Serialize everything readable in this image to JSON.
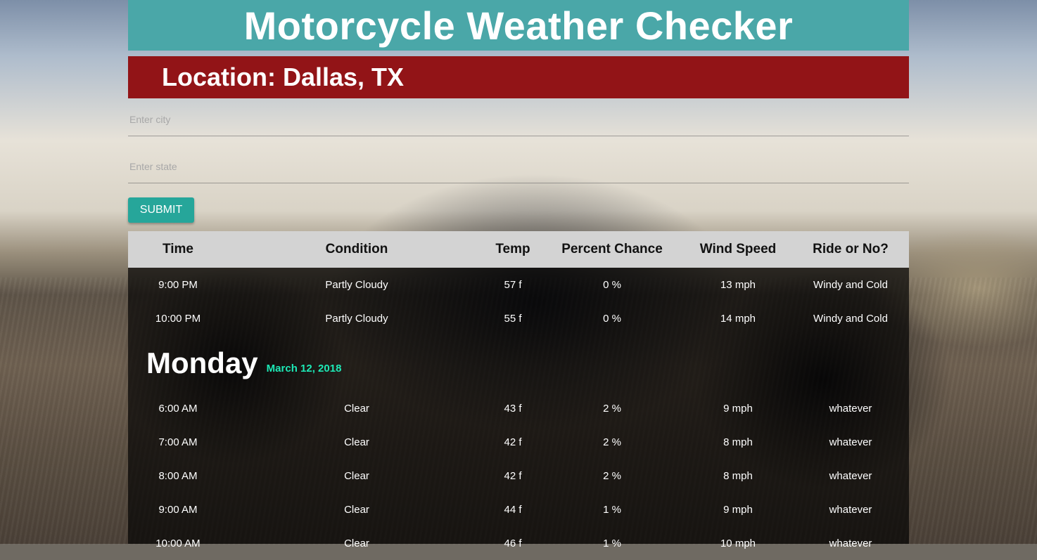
{
  "header": {
    "title": "Motorcycle Weather Checker"
  },
  "location": {
    "text": "Location: Dallas, TX"
  },
  "form": {
    "city_placeholder": "Enter city",
    "state_placeholder": "Enter state",
    "submit_label": "SUBMIT"
  },
  "table": {
    "headers": [
      "Time",
      "Condition",
      "Temp",
      "Percent Chance",
      "Wind Speed",
      "Ride or No?"
    ],
    "rows": [
      [
        "9:00 PM",
        "Partly Cloudy",
        "57 f",
        "0 %",
        "13 mph",
        "Windy and Cold"
      ],
      [
        "10:00 PM",
        "Partly Cloudy",
        "55 f",
        "0 %",
        "14 mph",
        "Windy and Cold"
      ]
    ]
  },
  "day": {
    "name": "Monday",
    "date": "March 12, 2018",
    "rows": [
      [
        "6:00 AM",
        "Clear",
        "43 f",
        "2 %",
        "9 mph",
        "whatever"
      ],
      [
        "7:00 AM",
        "Clear",
        "42 f",
        "2 %",
        "8 mph",
        "whatever"
      ],
      [
        "8:00 AM",
        "Clear",
        "42 f",
        "2 %",
        "8 mph",
        "whatever"
      ],
      [
        "9:00 AM",
        "Clear",
        "44 f",
        "1 %",
        "9 mph",
        "whatever"
      ],
      [
        "10:00 AM",
        "Clear",
        "46 f",
        "1 %",
        "10 mph",
        "whatever"
      ]
    ]
  },
  "colors": {
    "title_bar": "#4aa7a8",
    "location_bar": "#921417",
    "submit_button": "#26a69a",
    "date_accent": "#1de9b6"
  }
}
